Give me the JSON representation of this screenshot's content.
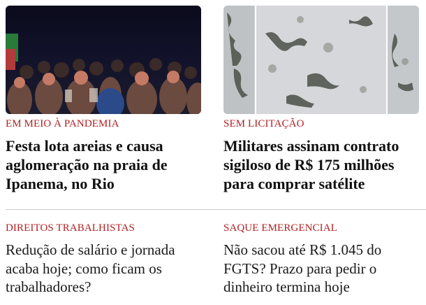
{
  "articles": [
    {
      "kicker": "EM MEIO À PANDEMIA",
      "headline": "Festa lota areias e causa aglomeração na praia de Ipanema, no Rio",
      "image": "crowd-at-night-photo"
    },
    {
      "kicker": "SEM LICITAÇÃO",
      "headline": "Militares assinam contrato sigiloso de R$ 175 milhões para comprar satélite",
      "image": "satellite-imagery-photo"
    },
    {
      "kicker": "DIREITOS TRABALHISTAS",
      "headline": "Redução de salário e jornada acaba hoje; como ficam os trabalhadores?"
    },
    {
      "kicker": "SAQUE EMERGENCIAL",
      "headline": "Não sacou até R$ 1.045 do FGTS? Prazo para pedir o dinheiro termina hoje"
    }
  ],
  "colors": {
    "kicker": "#b01e22",
    "headline": "#111111",
    "divider": "#c9c9d2"
  }
}
